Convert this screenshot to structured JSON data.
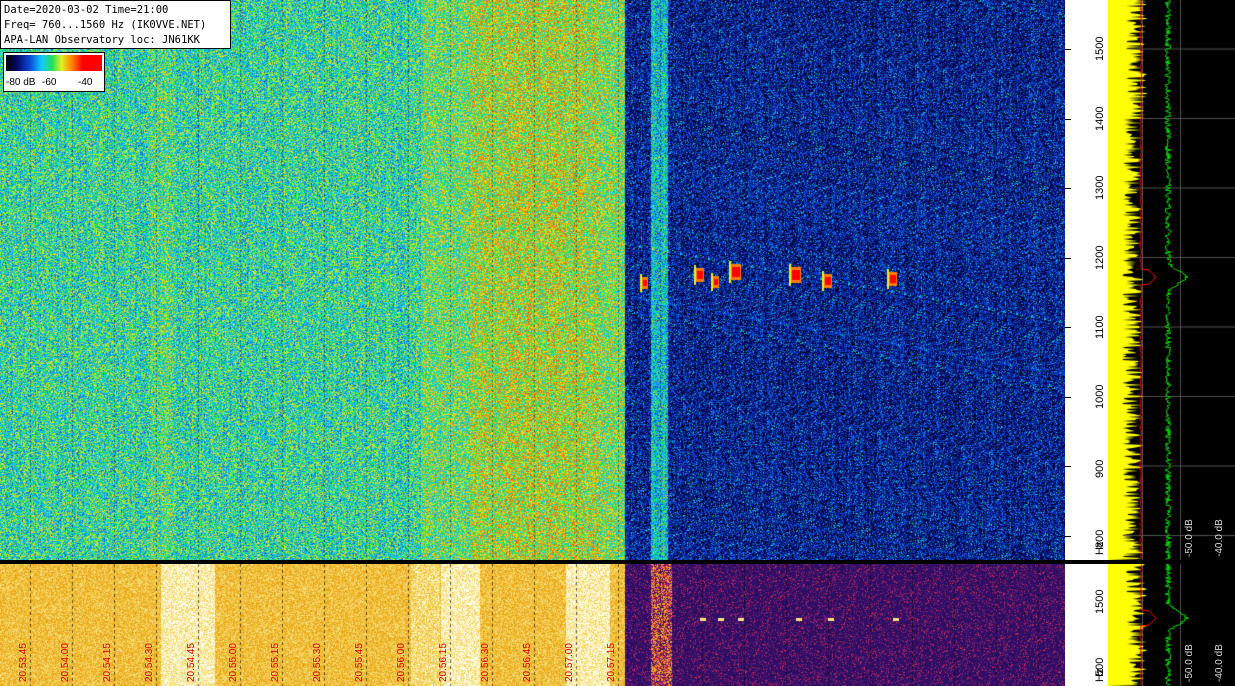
{
  "window": {
    "info_lines": [
      "Date=2020-03-02 Time=21:00",
      "Freq= 760...1560 Hz (IK0VVE.NET)",
      "APA-LAN Observatory loc: JN61KK"
    ]
  },
  "legend": {
    "labels": [
      "-80 dB",
      "-60",
      "-40"
    ]
  },
  "freq_axis": {
    "ticks": [
      "1500",
      "1400",
      "1300",
      "1200",
      "1100",
      "1000",
      "900",
      "800"
    ],
    "unit": "Hz"
  },
  "freq_axis_bottom": {
    "ticks": [
      "1500",
      "500"
    ],
    "unit": "Hz"
  },
  "spectrum": {
    "db_labels": [
      "-50.0 dB",
      "-40.0 dB"
    ]
  },
  "spectrum_bottom": {
    "db_labels": [
      "-50.0 dB",
      "-40.0 dB"
    ]
  },
  "timeline": {
    "labels": [
      "20.53.45",
      "20.54.00",
      "20.54.15",
      "20.54.30",
      "20.54.45",
      "20.55.00",
      "20.55.15",
      "20.55.30",
      "20.55.45",
      "20.56.00",
      "20.56.15",
      "20.56.30",
      "20.56.45",
      "20.57.00",
      "20.57.15"
    ]
  },
  "colors": {
    "waterfall_noise_green": "#4fb83a",
    "waterfall_dark": "#040a3a",
    "bottom_gold": "#e6a419",
    "bottom_purple": "#2a0e5a",
    "spectrum_yellow": "#ffff00",
    "spectrum_green": "#00e000",
    "spectrum_red": "#ff0000"
  },
  "icons": {
    "colormap": "colormap-scale-icon",
    "meteor_echo": "meteor-echo-trace"
  }
}
